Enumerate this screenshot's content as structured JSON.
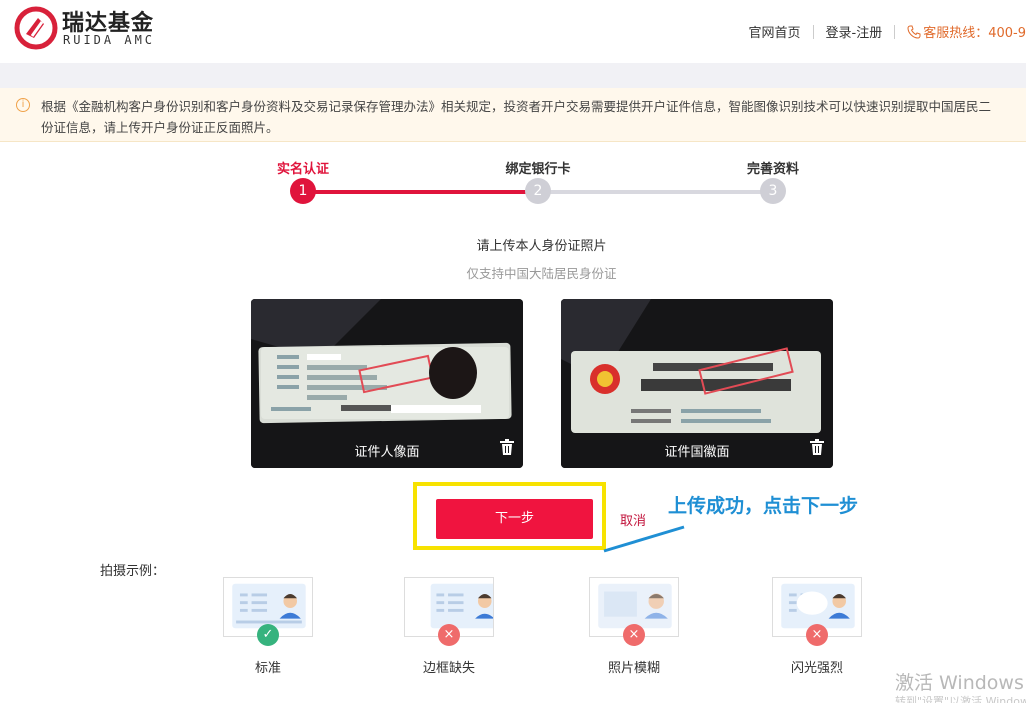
{
  "header": {
    "logo_cn": "瑞达基金",
    "logo_en": "RUIDA AMC",
    "nav_home": "官网首页",
    "nav_login": "登录-注册",
    "hotline": "客服热线：400-9"
  },
  "notice": {
    "line1": "根据《金融机构客户身份识别和客户身份资料及交易记录保存管理办法》相关规定，投资者开户交易需要提供开户证件信息，智能图像识别技术可以快速识别提取中国居民二",
    "line2": "份证信息，请上传开户身份证正反面照片。"
  },
  "steps": [
    {
      "label": "实名认证",
      "number": "1",
      "state": "active"
    },
    {
      "label": "绑定银行卡",
      "number": "2",
      "state": "todo"
    },
    {
      "label": "完善资料",
      "number": "3",
      "state": "todo"
    }
  ],
  "upload": {
    "title": "请上传本人身份证照片",
    "subtitle": "仅支持中国大陆居民身份证",
    "front_caption": "证件人像面",
    "back_caption": "证件国徽面"
  },
  "actions": {
    "next_label": "下一步",
    "cancel_label": "取消",
    "annotation": "上传成功，点击下一步"
  },
  "examples": {
    "label": "拍摄示例：",
    "items": [
      {
        "caption": "标准",
        "status": "ok"
      },
      {
        "caption": "边框缺失",
        "status": "bad"
      },
      {
        "caption": "照片模糊",
        "status": "bad"
      },
      {
        "caption": "闪光强烈",
        "status": "bad"
      }
    ]
  },
  "watermark": {
    "line1": "激活 Windows",
    "line2": "转到\"设置\"以激活 Windows"
  },
  "colors": {
    "brand_red": "#e0143c",
    "annotation_blue": "#1f8fd4",
    "highlight_yellow": "#f7e200"
  }
}
